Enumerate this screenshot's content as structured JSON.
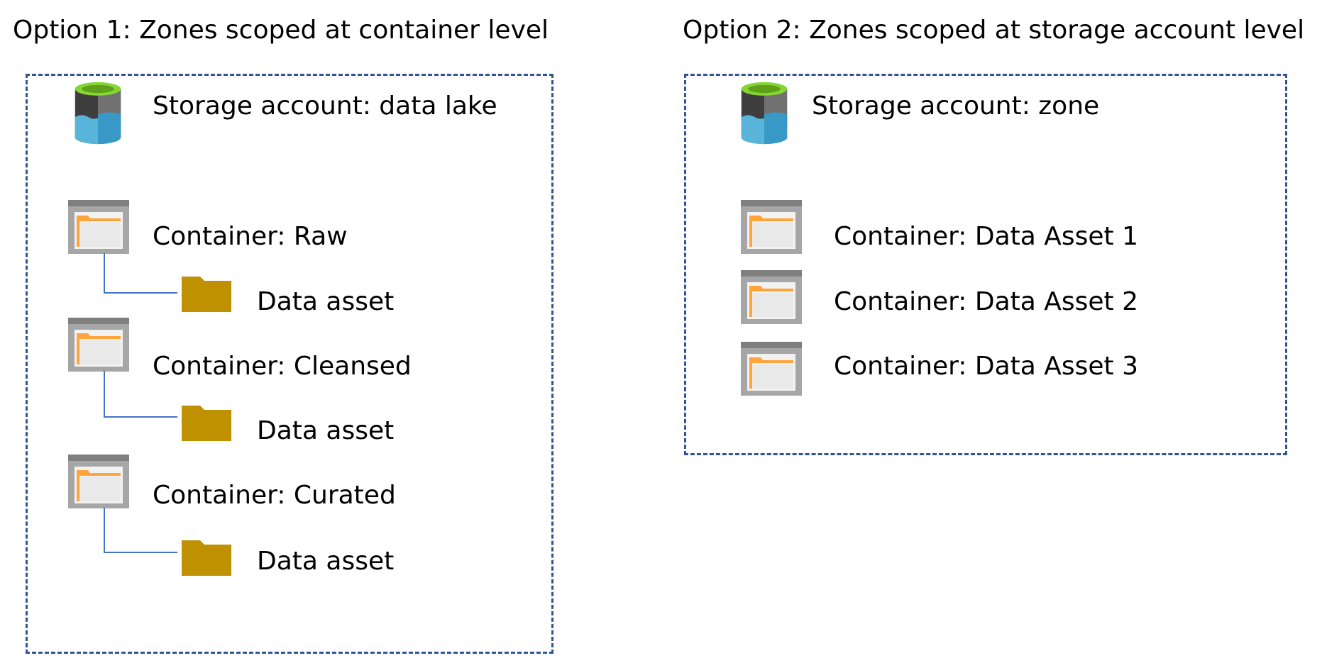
{
  "colors": {
    "frame": "#2F5597",
    "connector": "#4472C4",
    "folder": "#BF9000",
    "container_frame": "#A6A6A6",
    "container_bar": "#7F7F7F",
    "container_folder": "#FFA43C",
    "storage_top": "#86D633",
    "storage_dark": "#3E3E3E",
    "storage_water": "#59B4D9"
  },
  "option1": {
    "title": "Option 1: Zones scoped at container level",
    "storage_label": "Storage account: data lake",
    "containers": [
      {
        "label": "Container: Raw",
        "asset_label": "Data asset"
      },
      {
        "label": "Container: Cleansed",
        "asset_label": "Data asset"
      },
      {
        "label": "Container: Curated",
        "asset_label": "Data asset"
      }
    ]
  },
  "option2": {
    "title": "Option 2: Zones scoped at storage account level",
    "storage_label": "Storage account: zone",
    "containers": [
      {
        "label": "Container: Data Asset 1"
      },
      {
        "label": "Container: Data Asset 2"
      },
      {
        "label": "Container: Data Asset 3"
      }
    ]
  }
}
